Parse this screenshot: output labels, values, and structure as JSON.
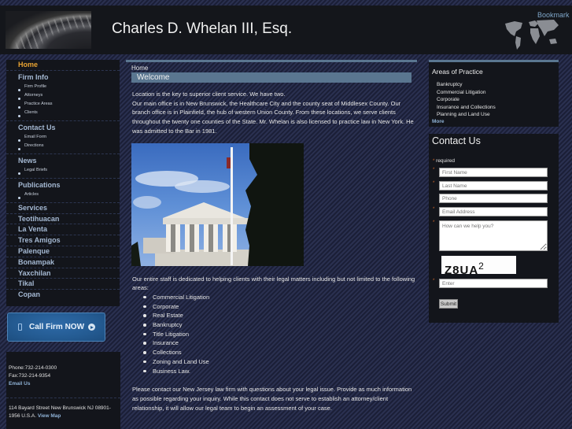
{
  "header": {
    "title": "Charles D. Whelan III, Esq.",
    "bookmark_label": "Bookmark"
  },
  "nav": {
    "home": "Home",
    "firm_info": "Firm Info",
    "firm_info_items": [
      "Firm Profile",
      "Attorneys",
      "Practice Areas",
      "Clients"
    ],
    "contact_us": "Contact Us",
    "contact_items": [
      "Email Form",
      "Directions"
    ],
    "news": "News",
    "news_items": [
      "Legal Briefs"
    ],
    "publications": "Publications",
    "publication_items": [
      "Articles"
    ],
    "links": [
      "Services",
      "Teotihuacan",
      "La Venta",
      "Tres Amigos",
      "Palenque",
      "Bonampak",
      "Yaxchilan",
      "Tikal",
      "Copan"
    ]
  },
  "call_button": {
    "label": "Call Firm NOW"
  },
  "contact_box": {
    "phone": "Phone:732-214-0300",
    "fax": "Fax:732-214-9354",
    "email_link": "Email Us",
    "address": "114 Bayard Street New Brunswick NJ 08901-1956 U.S.A.",
    "map_link": "View Map"
  },
  "main": {
    "breadcrumb": "Home",
    "heading": "Welcome",
    "intro_lines": [
      "Location is the key to superior client service.  We have two.",
      "Our main office is in New Brunswick, the Healthcare City and the county seat of Middlesex County.  Our branch office is in Plainfield, the hub of western Union County.  From these locations, we serve clients throughout the twenty one counties of the State.  Mr. Whelan is also licensed to practice law in New York.  He was admitted to the Bar in 1981."
    ],
    "photo_alt": "Supreme Court building with flag",
    "areas_intro": "Our entire staff is dedicated to helping clients with their legal matters including but not limited to the following areas:",
    "areas": [
      "Commercial Litigation",
      "Corporate",
      "Real Estate",
      "Bankruptcy",
      "Title Litigation",
      "Insurance",
      "Collections",
      "Zoning and Land Use",
      "Business Law."
    ],
    "closing": "Please contact our New Jersey law firm with questions about your legal issue. Provide as much information as possible regarding your inquiry. While this contact does not serve to establish an attorney/client relationship, it will allow our legal team to begin an assessment of your case."
  },
  "areas_of_practice": {
    "title": "Areas of Practice",
    "items": [
      "Bankruptcy",
      "Commercial Litigation",
      "Corporate",
      "Insurance and Collections",
      "Planning and Land Use"
    ],
    "more_label": "More"
  },
  "contact_form": {
    "title": "Contact Us",
    "required_note": "required",
    "required_marker": "*",
    "first_name_placeholder": "First Name",
    "last_name_placeholder": "Last Name",
    "phone_placeholder": "Phone",
    "email_placeholder": "Email Address",
    "message_placeholder": "How can we help you?",
    "captcha_text": "Z8UA",
    "captcha_sup": "2",
    "captcha_input_placeholder": "Enter",
    "submit_label": "Submit"
  }
}
